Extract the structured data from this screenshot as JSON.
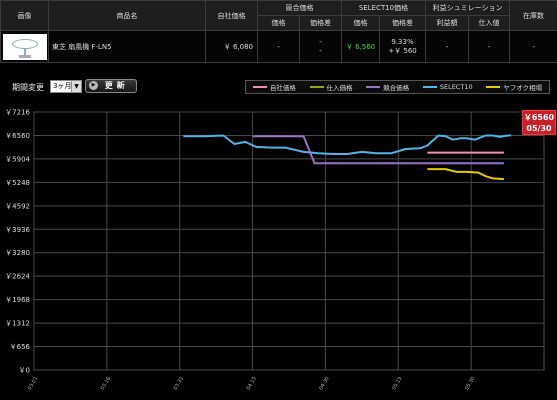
{
  "table": {
    "headers": {
      "image": "画像",
      "name": "商品名",
      "own_price": "自社価格",
      "competitor_group": "競合価格",
      "select_group": "SELECT10価格",
      "profit_group": "利益シュミレーション",
      "stock": "在庫数"
    },
    "subheaders": {
      "comp_price": "価格",
      "comp_diff": "価格差",
      "sel_price": "価格",
      "sel_diff": "価格差",
      "profit": "利益額",
      "purchase": "仕入値"
    },
    "row": {
      "name": "東芝 扇風機 F-LN5",
      "own_price": "￥ 6,080",
      "comp_price": "-",
      "comp_diff_1": "-",
      "comp_diff_2": "-",
      "sel_price": "￥ 6,560",
      "sel_diff_pct": "9.33%",
      "sel_diff_amt": "+￥ 560",
      "profit": "-",
      "purchase": "-",
      "stock": "-"
    }
  },
  "controls": {
    "period_label": "期間変更",
    "period_value": "3ヶ月",
    "period_arrow": "▼",
    "update_icon": "▶",
    "update_label": "更新"
  },
  "legend": [
    {
      "label": "自社価格",
      "color": "#f48fb1"
    },
    {
      "label": "仕入価格",
      "color": "#a0a020"
    },
    {
      "label": "競合価格",
      "color": "#9b72c8"
    },
    {
      "label": "SELECT10",
      "color": "#4fb4e6"
    },
    {
      "label": "ヤフオク相場",
      "color": "#e6c800"
    }
  ],
  "badge": {
    "price": "￥6560",
    "date": "05/30"
  },
  "chart_data": {
    "type": "line",
    "ylim": [
      0,
      7216
    ],
    "yticks": [
      0,
      656,
      1312,
      1968,
      2624,
      3280,
      3936,
      4592,
      5248,
      5904,
      6560,
      7216
    ],
    "ytick_labels": [
      "￥0",
      "￥656",
      "￥1312",
      "￥1968",
      "￥2624",
      "￥3280",
      "￥3936",
      "￥4592",
      "￥5248",
      "￥5904",
      "￥6560",
      "￥7216"
    ],
    "xlim": [
      0,
      7
    ],
    "xticks": [
      0,
      1,
      2,
      3,
      4,
      5,
      6,
      7
    ],
    "xtick_labels": [
      "03.01",
      "03.16",
      "03.31",
      "04.15",
      "04.30",
      "05.15",
      "05.30",
      ""
    ],
    "grid": true,
    "series": [
      {
        "name": "SELECT10",
        "color": "#4fb4e6",
        "x": [
          2.05,
          2.35,
          2.6,
          2.75,
          2.9,
          3.05,
          3.25,
          3.45,
          3.7,
          3.9,
          4.1,
          4.3,
          4.5,
          4.7,
          4.9,
          5.1,
          5.3,
          5.4,
          5.55,
          5.65,
          5.75,
          5.85,
          5.95,
          6.05,
          6.2,
          6.3,
          6.4,
          6.5,
          6.55
        ],
        "y": [
          6540,
          6540,
          6560,
          6320,
          6380,
          6240,
          6220,
          6220,
          6100,
          6060,
          6040,
          6040,
          6100,
          6060,
          6060,
          6180,
          6200,
          6280,
          6560,
          6540,
          6440,
          6480,
          6480,
          6440,
          6560,
          6560,
          6520,
          6560,
          6560
        ]
      },
      {
        "name": "競合価格",
        "color": "#9b72c8",
        "x": [
          3.0,
          3.7,
          3.85,
          6.45
        ],
        "y": [
          6540,
          6540,
          5780,
          5780
        ]
      },
      {
        "name": "自社価格",
        "color": "#f48fb1",
        "x": [
          5.4,
          6.45
        ],
        "y": [
          6080,
          6080
        ]
      },
      {
        "name": "ヤフオク相場",
        "color": "#e6c800",
        "x": [
          5.4,
          5.65,
          5.8,
          5.95,
          6.1,
          6.2,
          6.3,
          6.45
        ],
        "y": [
          5620,
          5620,
          5540,
          5540,
          5520,
          5420,
          5360,
          5340
        ]
      }
    ]
  }
}
